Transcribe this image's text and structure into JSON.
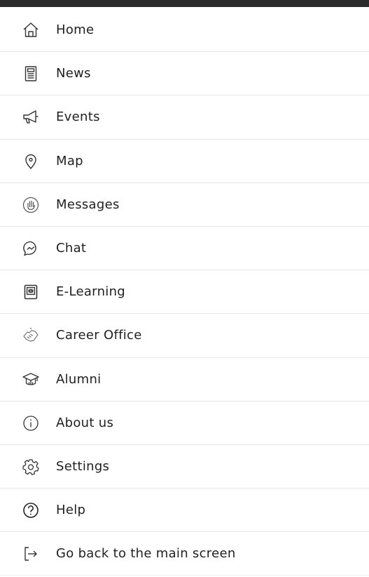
{
  "colors": {
    "top_bar": "#2b2b2b",
    "text": "#1f1f1f",
    "icon": "#333333",
    "divider": "#e6e6e6",
    "background": "#ffffff"
  },
  "menu": {
    "items": [
      {
        "label": "Home",
        "icon": "home-icon"
      },
      {
        "label": "News",
        "icon": "news-icon"
      },
      {
        "label": "Events",
        "icon": "megaphone-icon"
      },
      {
        "label": "Map",
        "icon": "map-pin-icon"
      },
      {
        "label": "Messages",
        "icon": "hand-icon"
      },
      {
        "label": "Chat",
        "icon": "chat-icon"
      },
      {
        "label": "E-Learning",
        "icon": "e-learning-icon"
      },
      {
        "label": "Career Office",
        "icon": "handshake-icon"
      },
      {
        "label": "Alumni",
        "icon": "graduation-cap-icon"
      },
      {
        "label": "About us",
        "icon": "info-icon"
      },
      {
        "label": "Settings",
        "icon": "gear-icon"
      },
      {
        "label": "Help",
        "icon": "question-icon"
      },
      {
        "label": "Go back to the main screen",
        "icon": "exit-icon"
      }
    ]
  }
}
